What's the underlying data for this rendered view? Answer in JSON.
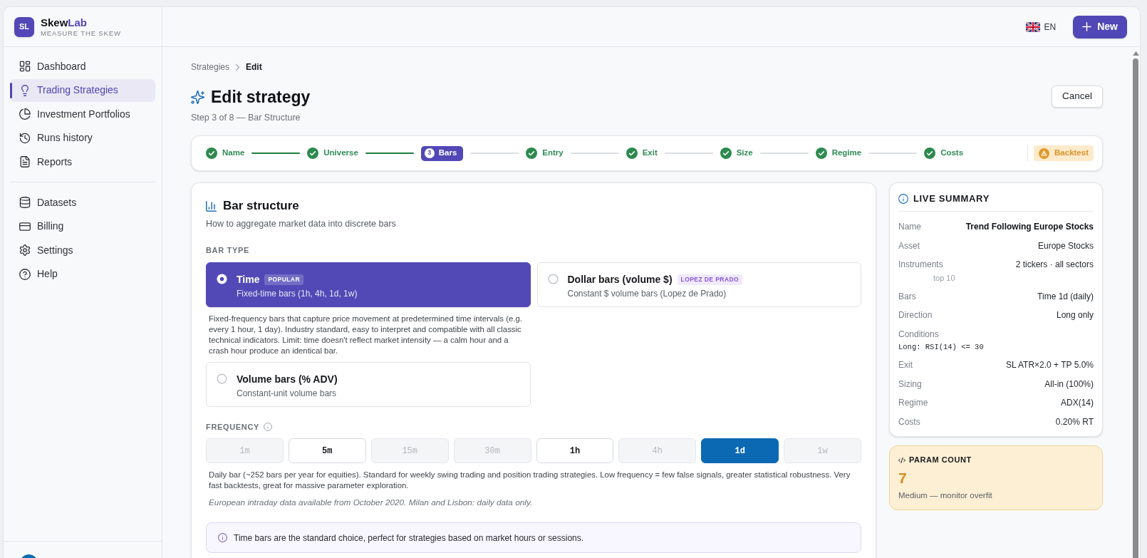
{
  "app": {
    "logo_initials": "SL",
    "wordmark": [
      {
        "text": "Skew",
        "accent": false
      },
      {
        "text": "Lab",
        "accent": true
      }
    ],
    "tagline": "MEASURE THE SKEW"
  },
  "sidebar": {
    "groups": [
      {
        "items": [
          {
            "label": "Dashboard",
            "selected": false
          },
          {
            "label": "Trading Strategies",
            "selected": true
          },
          {
            "label": "Investment Portfolios",
            "selected": false
          },
          {
            "label": "Runs history",
            "selected": false
          },
          {
            "label": "Reports",
            "selected": false
          }
        ]
      },
      {
        "items": [
          {
            "label": "Datasets",
            "selected": false
          },
          {
            "label": "Billing",
            "selected": false
          },
          {
            "label": "Settings",
            "selected": false
          },
          {
            "label": "Help",
            "selected": false
          }
        ]
      }
    ]
  },
  "header": {
    "language": "EN",
    "new_button": "New"
  },
  "breadcrumb": [
    {
      "label": "Strategies",
      "current": false
    },
    {
      "label": "Edit",
      "current": true
    }
  ],
  "page": {
    "title": "Edit strategy",
    "subtitle": "Step 3 of 8 — Bar Structure",
    "cancel_button": "Cancel"
  },
  "stepper": {
    "steps": [
      {
        "label": "Name",
        "completed": true,
        "selected": false
      },
      {
        "label": "Universe",
        "completed": true,
        "selected": false
      },
      {
        "label": "Bars",
        "number": "3",
        "completed": false,
        "selected": true
      },
      {
        "label": "Entry",
        "completed": true,
        "selected": false
      },
      {
        "label": "Exit",
        "completed": true,
        "selected": false
      },
      {
        "label": "Size",
        "completed": true,
        "selected": false
      },
      {
        "label": "Regime",
        "completed": true,
        "selected": false
      },
      {
        "label": "Costs",
        "completed": true,
        "selected": false
      }
    ],
    "final": {
      "label": "Backtest",
      "kind": "warning"
    }
  },
  "bar_structure": {
    "title": "Bar structure",
    "subtitle": "How to aggregate market data into discrete bars",
    "bar_type_label": "BAR TYPE",
    "options": [
      {
        "title": "Time",
        "badge": "POPULAR",
        "description": "Fixed-time bars (1h, 4h, 1d, 1w)",
        "selected": true,
        "details": "Fixed-frequency bars that capture price movement at predetermined time intervals (e.g. every 1 hour, 1 day). Industry standard, easy to interpret and compatible with all classic technical indicators. Limit: time doesn't reflect market intensity — a calm hour and a crash hour produce an identical bar."
      },
      {
        "title": "Dollar bars (volume $)",
        "badge": "LOPEZ DE PRADO",
        "description": "Constant $ volume bars (Lopez de Prado)",
        "selected": false
      },
      {
        "title": "Volume bars (% ADV)",
        "description": "Constant-unit volume bars",
        "selected": false
      }
    ],
    "frequency": {
      "label": "FREQUENCY",
      "options": [
        {
          "label": "1m",
          "disabled": true,
          "selected": false
        },
        {
          "label": "5m",
          "disabled": false,
          "selected": false
        },
        {
          "label": "15m",
          "disabled": true,
          "selected": false
        },
        {
          "label": "30m",
          "disabled": true,
          "selected": false
        },
        {
          "label": "1h",
          "disabled": false,
          "selected": false
        },
        {
          "label": "4h",
          "disabled": true,
          "selected": false
        },
        {
          "label": "1d",
          "disabled": false,
          "selected": true
        },
        {
          "label": "1w",
          "disabled": true,
          "selected": false
        }
      ],
      "description": "Daily bar (~252 bars per year for equities). Standard for weekly swing trading and position trading strategies. Low frequency = few false signals, greater statistical robustness. Very fast backtests, great for massive parameter exploration.",
      "note": "European intraday data available from October 2020. Milan and Lisbon: daily data only."
    },
    "tip": "Time bars are the standard choice, perfect for strategies based on market hours or sessions."
  },
  "live_summary": {
    "title": "LIVE SUMMARY",
    "rows": [
      {
        "kind": "pair",
        "label": "Name",
        "value": "Trend Following Europe Stocks",
        "strong": true
      },
      {
        "kind": "pair",
        "label": "Asset",
        "value": "Europe Stocks",
        "strong": false
      },
      {
        "kind": "pair",
        "label": "Instruments",
        "value": "2 tickers · all sectors",
        "strong": false,
        "note": "top 10"
      },
      {
        "kind": "pair",
        "label": "Bars",
        "value": "Time 1d (daily)",
        "strong": false
      },
      {
        "kind": "pair",
        "label": "Direction",
        "value": "Long only",
        "strong": false
      },
      {
        "kind": "code",
        "label": "Conditions",
        "value": "Long: RSI(14) <= 30"
      },
      {
        "kind": "pair",
        "label": "Exit",
        "value": "SL ATR×2.0 + TP 5.0%",
        "strong": false
      },
      {
        "kind": "pair",
        "label": "Sizing",
        "value": "All-in (100%)",
        "strong": false
      },
      {
        "kind": "pair",
        "label": "Regime",
        "value": "ADX(14)",
        "strong": false
      },
      {
        "kind": "pair",
        "label": "Costs",
        "value": "0.20% RT",
        "strong": false
      }
    ]
  },
  "param_count": {
    "title": "PARAM COUNT",
    "value": "7",
    "caption": "Medium — monitor overfit"
  }
}
